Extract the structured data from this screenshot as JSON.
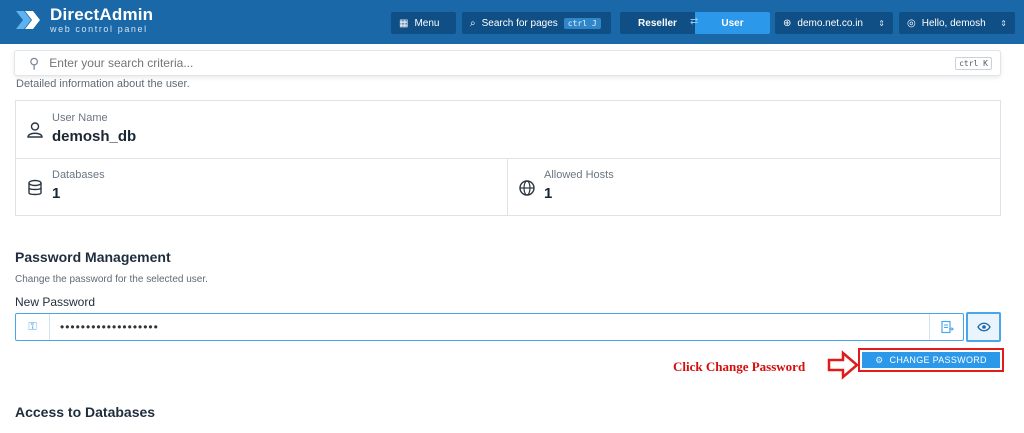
{
  "app": {
    "name": "DirectAdmin",
    "subtitle": "web control panel"
  },
  "topbar": {
    "menu_label": "Menu",
    "search_label": "Search for pages",
    "search_shortcut": "ctrl J",
    "role_reseller": "Reseller",
    "role_user": "User",
    "domain": "demo.net.co.in",
    "greeting": "Hello, demosh"
  },
  "searchbar": {
    "placeholder": "Enter your search criteria...",
    "shortcut": "ctrl K"
  },
  "intro": "Detailed information about the user.",
  "user_info": {
    "username_label": "User Name",
    "username": "demosh_db",
    "databases_label": "Databases",
    "databases": "1",
    "hosts_label": "Allowed Hosts",
    "hosts": "1"
  },
  "password": {
    "title": "Password Management",
    "description": "Change the password for the selected user.",
    "field_label": "New Password",
    "value": "•••••••••••••••••••",
    "button_label": "CHANGE PASSWORD"
  },
  "annotation": {
    "text": "Click Change Password",
    "color": "#d40d0d"
  },
  "next_section": {
    "title": "Access to Databases"
  },
  "colors": {
    "brand": "#1b68a8",
    "accent": "#2c98e9",
    "highlight": "#e01b1b"
  }
}
